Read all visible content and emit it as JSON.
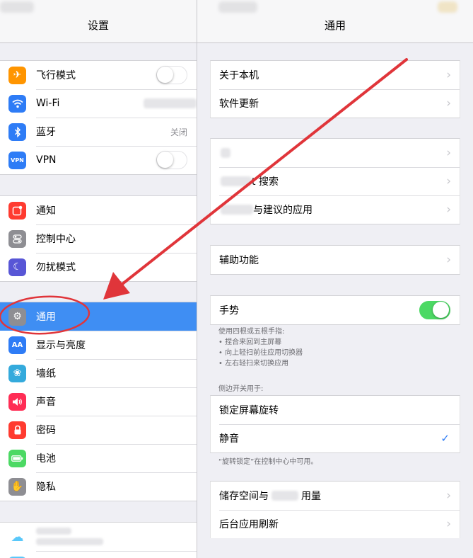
{
  "left": {
    "title": "设置",
    "groups": [
      [
        {
          "label": "飞行模式",
          "icon": "airplane-icon",
          "color": "#ff9500",
          "toggle": false
        },
        {
          "label": "Wi-Fi",
          "icon": "wifi-icon",
          "color": "#2e7cf6"
        },
        {
          "label": "蓝牙",
          "icon": "bluetooth-icon",
          "color": "#2e7cf6",
          "value": "关闭"
        },
        {
          "label": "VPN",
          "icon": "vpn-icon",
          "color": "#2e7cf6",
          "icon_text": "VPN",
          "toggle": false
        }
      ],
      [
        {
          "label": "通知",
          "icon": "notification-icon",
          "color": "#ff3b30"
        },
        {
          "label": "控制中心",
          "icon": "control-center-icon",
          "color": "#8e8e93"
        },
        {
          "label": "勿扰模式",
          "icon": "moon-icon",
          "color": "#5856d6"
        }
      ],
      [
        {
          "label": "通用",
          "icon": "gear-icon",
          "color": "#8e8e93",
          "selected": true
        },
        {
          "label": "显示与亮度",
          "icon": "display-brightness-icon",
          "color": "#2e7cf6",
          "icon_text": "AA"
        },
        {
          "label": "墙纸",
          "icon": "wallpaper-icon",
          "color": "#34aadc"
        },
        {
          "label": "声音",
          "icon": "speaker-icon",
          "color": "#ff2d55"
        },
        {
          "label": "密码",
          "icon": "lock-icon",
          "color": "#ff3b30"
        },
        {
          "label": "电池",
          "icon": "battery-icon",
          "color": "#4cd964"
        },
        {
          "label": "隐私",
          "icon": "hand-icon",
          "color": "#8e8e93"
        }
      ]
    ]
  },
  "right": {
    "title": "通用",
    "group1": [
      "关于本机",
      "软件更新"
    ],
    "group2": [
      "",
      "t 搜索",
      "与建议的应用"
    ],
    "group3": [
      "辅助功能"
    ],
    "gesture": {
      "label": "手势",
      "on": true,
      "description": "使用四根或五根手指:",
      "bullets": [
        "• 捏合来回到主屏幕",
        "• 向上轻扫前往应用切换器",
        "• 左右轻扫来切换应用"
      ]
    },
    "side_switch": {
      "header": "侧边开关用于:",
      "options": [
        "锁定屏幕旋转",
        "静音"
      ],
      "checked_index": 1,
      "footnote": "“旋转锁定”在控制中心中可用。"
    },
    "storage": {
      "prefix": "储存空间与",
      "suffix": "用量"
    },
    "background_refresh": "后台应用刷新"
  },
  "annotation_color": "#e0353a"
}
